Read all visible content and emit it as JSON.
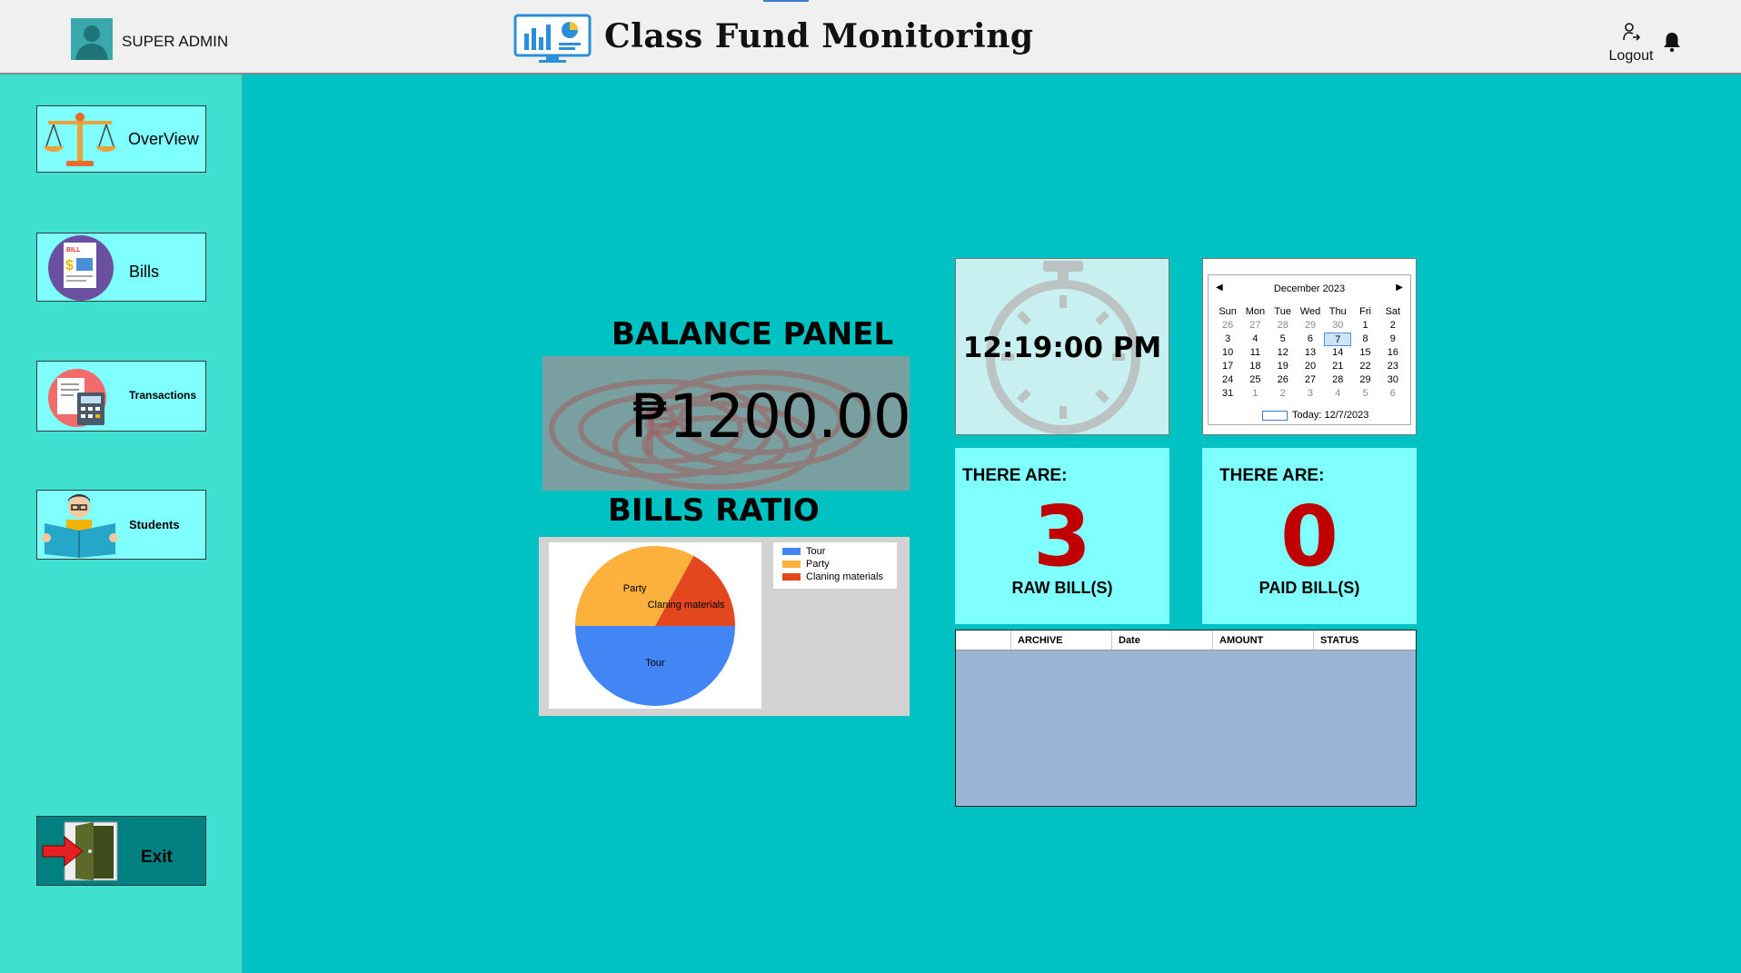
{
  "header": {
    "user": "SUPER ADMIN",
    "title": "Class Fund Monitoring",
    "logout": "Logout"
  },
  "sidebar": {
    "items": [
      {
        "label": "OverView"
      },
      {
        "label": "Bills"
      },
      {
        "label": "Transactions"
      },
      {
        "label": "Students"
      }
    ],
    "exit": "Exit"
  },
  "balance": {
    "title": "BALANCE PANEL",
    "value": "₱1200.00"
  },
  "bills_ratio": {
    "title": "BILLS RATIO"
  },
  "chart_data": {
    "type": "pie",
    "title": "",
    "categories": [
      "Tour",
      "Party",
      "Claning materials"
    ],
    "values": [
      50,
      33,
      17
    ],
    "colors": [
      "#4285f4",
      "#fbb13c",
      "#e2471d"
    ],
    "legend": "top-right"
  },
  "clock": {
    "time": "12:19:00 PM"
  },
  "calendar": {
    "month": "December 2023",
    "days": [
      "Sun",
      "Mon",
      "Tue",
      "Wed",
      "Thu",
      "Fri",
      "Sat"
    ],
    "weeks": [
      [
        "26",
        "27",
        "28",
        "29",
        "30",
        "1",
        "2"
      ],
      [
        "3",
        "4",
        "5",
        "6",
        "7",
        "8",
        "9"
      ],
      [
        "10",
        "11",
        "12",
        "13",
        "14",
        "15",
        "16"
      ],
      [
        "17",
        "18",
        "19",
        "20",
        "21",
        "22",
        "23"
      ],
      [
        "24",
        "25",
        "26",
        "27",
        "28",
        "29",
        "30"
      ],
      [
        "31",
        "1",
        "2",
        "3",
        "4",
        "5",
        "6"
      ]
    ],
    "selected": "7",
    "today": "Today: 12/7/2023"
  },
  "stats": [
    {
      "prefix": "THERE ARE:",
      "count": "3",
      "label": "RAW BILL(S)"
    },
    {
      "prefix": "THERE ARE:",
      "count": "0",
      "label": "PAID BILL(S)"
    }
  ],
  "table": {
    "columns": [
      "",
      "ARCHIVE",
      "Date",
      "AMOUNT",
      "STATUS"
    ],
    "rows": []
  }
}
